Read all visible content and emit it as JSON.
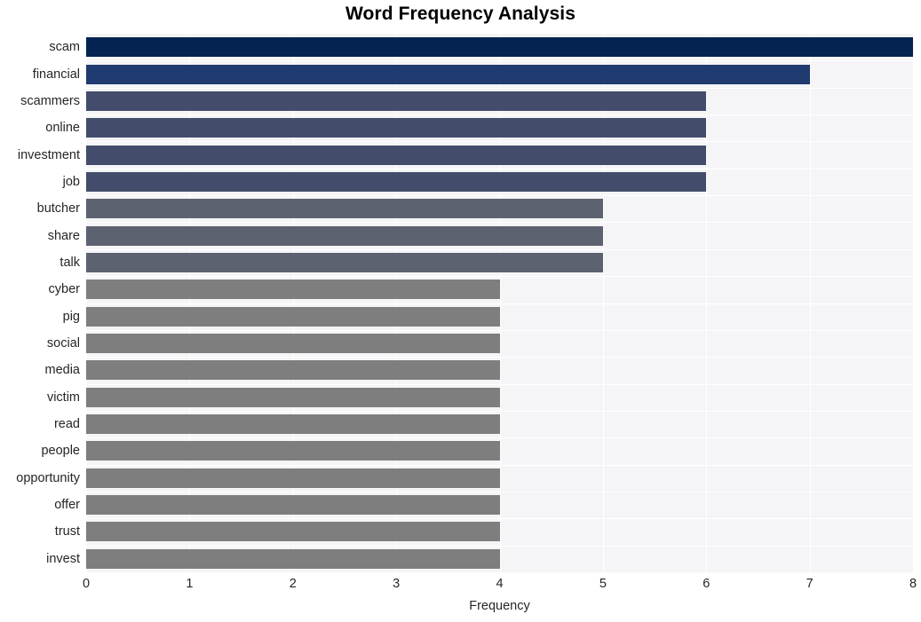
{
  "chart_data": {
    "type": "bar",
    "orientation": "horizontal",
    "title": "Word Frequency Analysis",
    "xlabel": "Frequency",
    "ylabel": "",
    "xlim": [
      0,
      8
    ],
    "xticks": [
      0,
      1,
      2,
      3,
      4,
      5,
      6,
      7,
      8
    ],
    "xtick_labels": [
      "0",
      "1",
      "2",
      "3",
      "4",
      "5",
      "6",
      "7",
      "8"
    ],
    "grid": true,
    "legend": null,
    "categories": [
      "scam",
      "financial",
      "scammers",
      "online",
      "investment",
      "job",
      "butcher",
      "share",
      "talk",
      "cyber",
      "pig",
      "social",
      "media",
      "victim",
      "read",
      "people",
      "opportunity",
      "offer",
      "trust",
      "invest"
    ],
    "values": [
      8,
      7,
      6,
      6,
      6,
      6,
      5,
      5,
      5,
      4,
      4,
      4,
      4,
      4,
      4,
      4,
      4,
      4,
      4,
      4
    ],
    "bar_colors": [
      "#042351",
      "#1f3b70",
      "#434d6b",
      "#434d6b",
      "#434d6b",
      "#434d6b",
      "#5d6270",
      "#5d6270",
      "#5d6270",
      "#7e7e7e",
      "#7e7e7e",
      "#7e7e7e",
      "#7e7e7e",
      "#7e7e7e",
      "#7e7e7e",
      "#7e7e7e",
      "#7e7e7e",
      "#7e7e7e",
      "#7e7e7e",
      "#7e7e7e"
    ],
    "plot_background": "#f5f5f7",
    "gridline_color": "#ffffff",
    "figure_background": "#ffffff",
    "text_color": "#262626"
  }
}
